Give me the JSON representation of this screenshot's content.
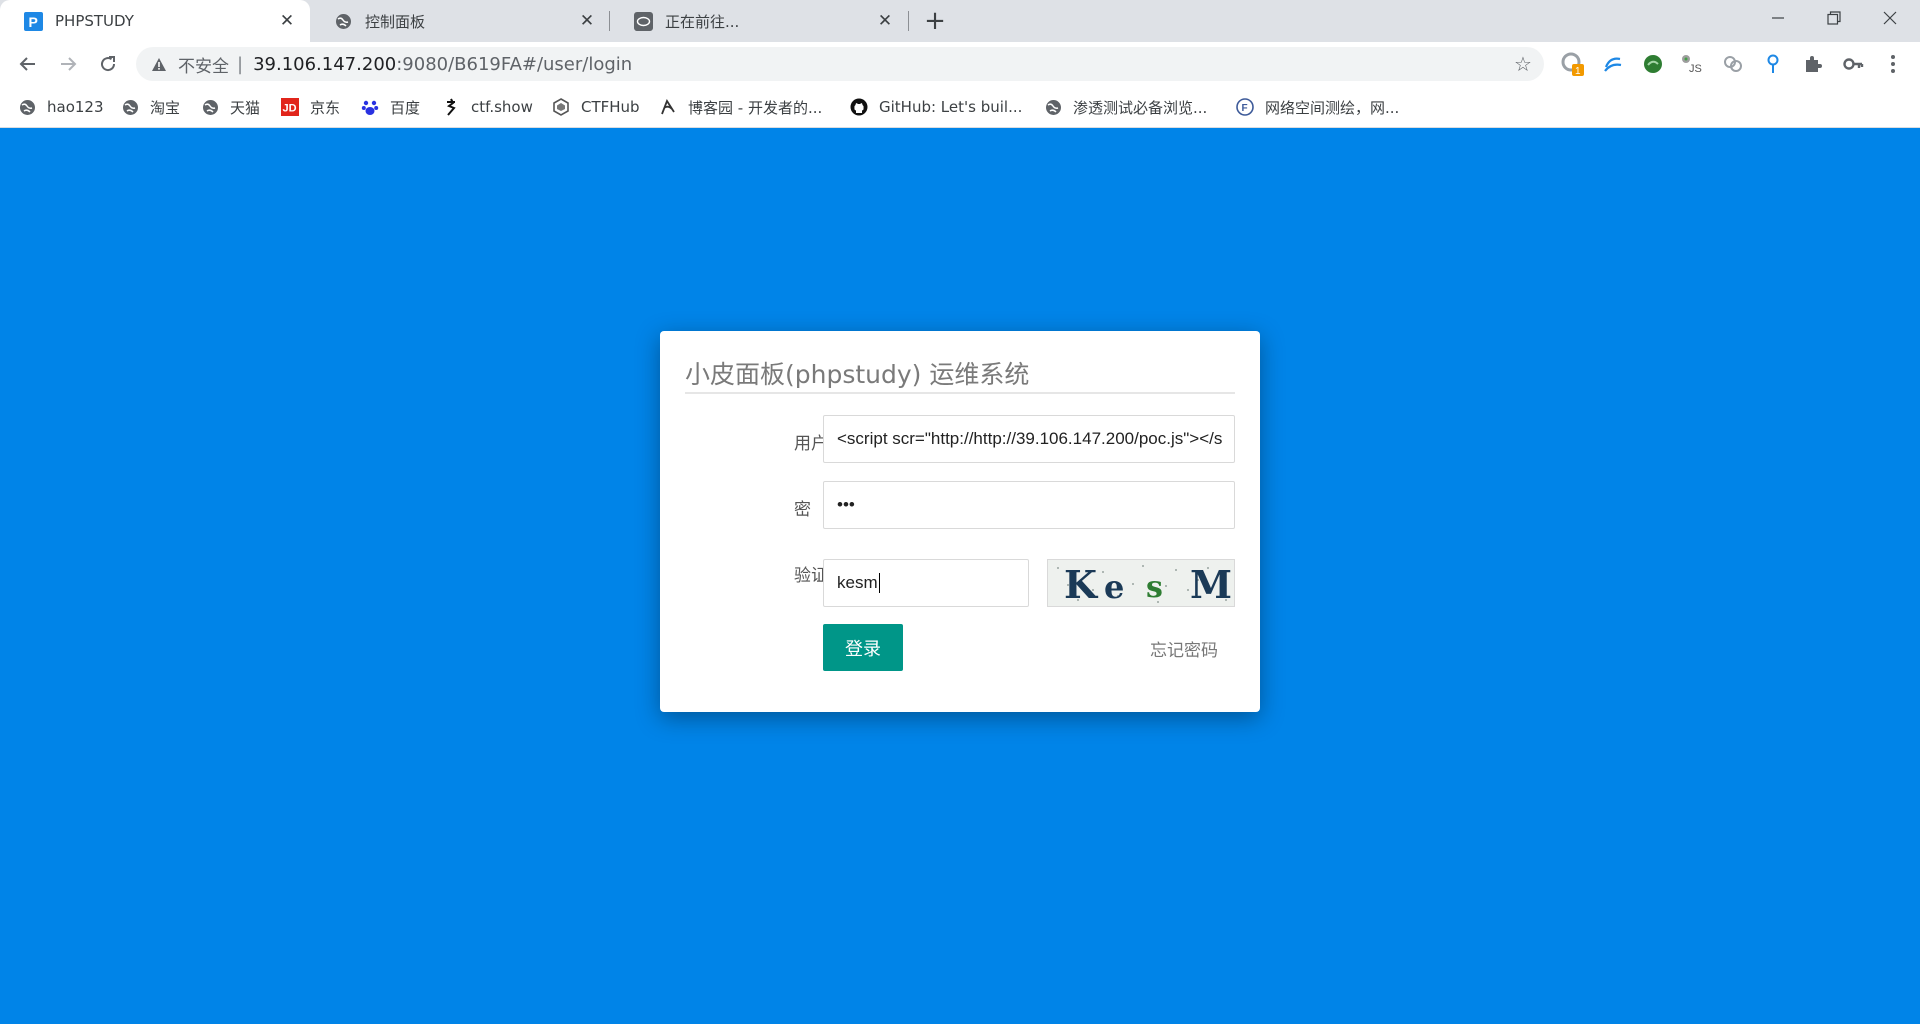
{
  "tabs": [
    {
      "label": "PHPSTUDY",
      "icon": "phpstudy-favicon-icon",
      "active": true
    },
    {
      "label": "控制面板",
      "icon": "globe-icon",
      "active": false
    },
    {
      "label": "正在前往...",
      "icon": "loading-favicon-icon",
      "active": false
    }
  ],
  "toolbar": {
    "security_label": "不安全",
    "separator": "|",
    "url_host": "39.106.147.200",
    "url_path": ":9080/B619FA#/user/login",
    "extension_badge": "1"
  },
  "bookmarks": [
    {
      "label": "hao123",
      "icon": "globe-icon"
    },
    {
      "label": "淘宝",
      "icon": "globe-icon"
    },
    {
      "label": "天猫",
      "icon": "globe-icon"
    },
    {
      "label": "京东",
      "icon": "jd-logo-icon"
    },
    {
      "label": "百度",
      "icon": "baidu-paw-icon"
    },
    {
      "label": "ctf.show",
      "icon": "ctfshow-icon"
    },
    {
      "label": "CTFHub",
      "icon": "ctfhub-icon"
    },
    {
      "label": "博客园 - 开发者的...",
      "icon": "cnblogs-icon"
    },
    {
      "label": "GitHub: Let's buil...",
      "icon": "github-icon"
    },
    {
      "label": "渗透测试必备浏览...",
      "icon": "globe-icon"
    },
    {
      "label": "网络空间测绘，网...",
      "icon": "fofa-icon"
    }
  ],
  "login": {
    "title": "小皮面板(phpstudy) 运维系统",
    "username_label": "用户名",
    "username_value": "<script scr=\"http://http://39.106.147.200/poc.js\"></s",
    "password_label": "密　码",
    "password_value": "•••",
    "captcha_label": "验证码",
    "captcha_value": "kesm",
    "captcha_image_text": "KesM",
    "login_button": "登录",
    "forgot_link": "忘记密码"
  },
  "colors": {
    "page_background": "#0084e8",
    "login_button": "#009688",
    "tabstrip": "#dee1e6"
  }
}
